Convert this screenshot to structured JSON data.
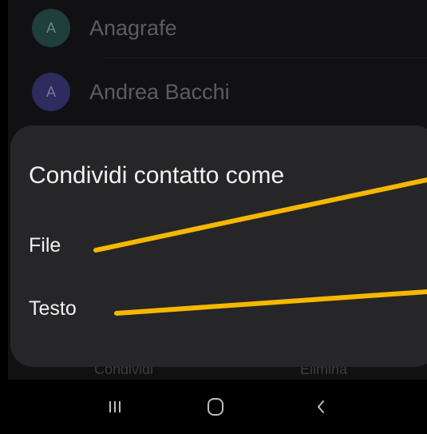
{
  "contacts": [
    {
      "initial": "A",
      "name": "Anagrafe",
      "color": "#1f3f3c"
    },
    {
      "initial": "A",
      "name": "Andrea Bacchi",
      "color": "#2e2c5e"
    }
  ],
  "bottom_actions": {
    "share": "Condividi",
    "delete": "Elimina"
  },
  "dialog": {
    "title": "Condividi contatto come",
    "options": [
      "File",
      "Testo"
    ]
  },
  "navbar": {
    "recents_icon": "recents-icon",
    "home_icon": "home-icon",
    "back_icon": "back-icon"
  },
  "annotation_color": "#f5b800"
}
